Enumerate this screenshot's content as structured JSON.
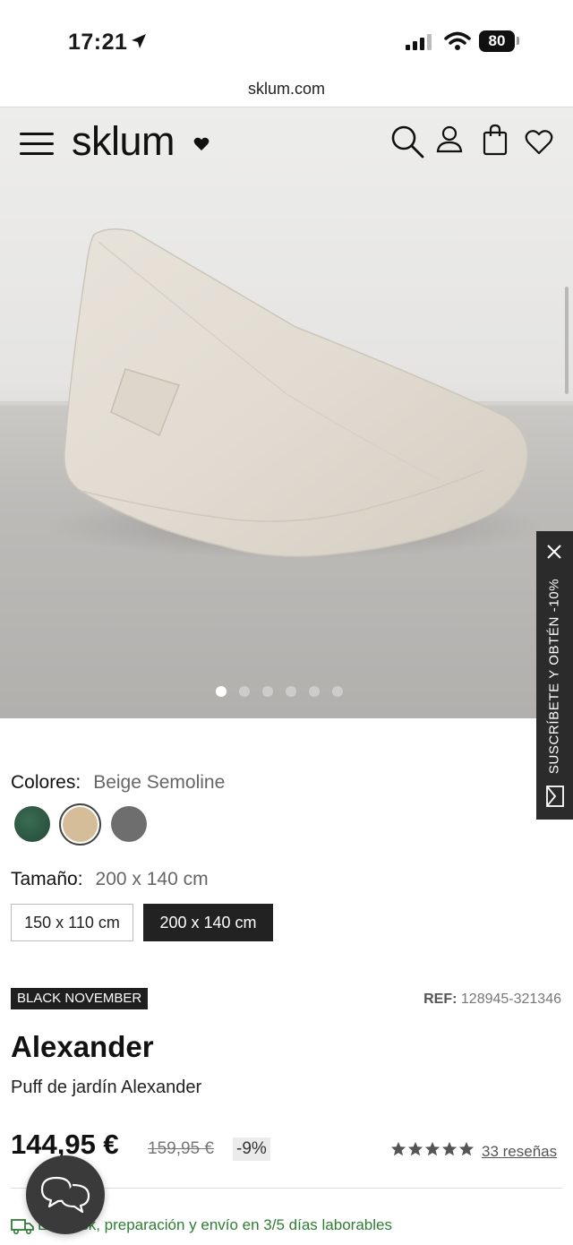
{
  "status_bar": {
    "time": "17:21",
    "battery": "80"
  },
  "browser": {
    "url": "sklum.com"
  },
  "header": {
    "logo": "sklum"
  },
  "product": {
    "colors_label": "Colores:",
    "selected_color": "Beige Semoline",
    "swatches": [
      {
        "name": "green",
        "color": "#2f5a44"
      },
      {
        "name": "beige",
        "color": "#d6bd99"
      },
      {
        "name": "grey",
        "color": "#6e6e6e"
      }
    ],
    "size_label": "Tamaño:",
    "selected_size": "200 x 140 cm",
    "sizes": [
      "150 x 110 cm",
      "200 x 140 cm"
    ],
    "badge": "BLACK NOVEMBER",
    "ref_label": "REF:",
    "ref": "128945-321346",
    "name": "Alexander",
    "subtitle": "Puff de jardín Alexander",
    "price": "144,95 €",
    "old_price": "159,95 €",
    "discount": "-9%",
    "rating": 5,
    "reviews": "33 reseñas",
    "stock": "En stock, preparación y envío en 3/5 días laborables"
  },
  "carousel": {
    "slides": 6,
    "active": 0
  },
  "subscribe": {
    "text": "SUSCRÍBETE Y OBTÉN -10%"
  }
}
